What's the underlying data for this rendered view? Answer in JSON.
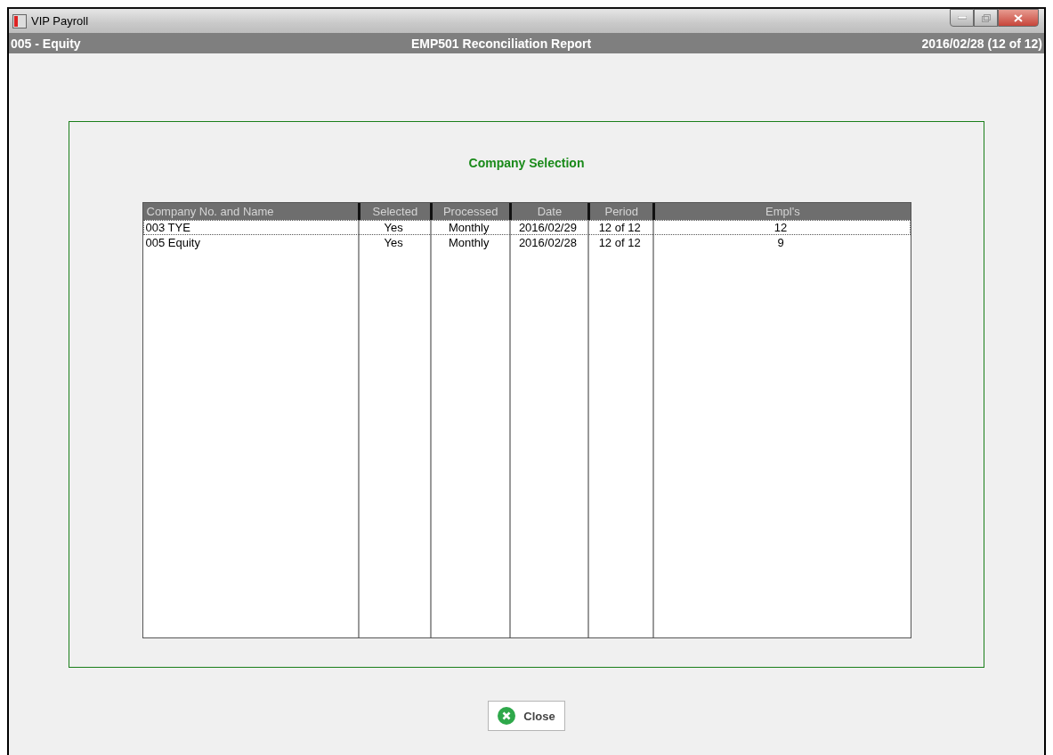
{
  "window": {
    "title": "VIP Payroll"
  },
  "header": {
    "company": "005 - Equity",
    "report": "EMP501 Reconciliation Report",
    "period": "2016/02/28 (12 of 12)"
  },
  "panel": {
    "title": "Company Selection"
  },
  "table": {
    "columns": [
      "Company No. and Name",
      "Selected",
      "Processed",
      "Date",
      "Period",
      "Empl's"
    ],
    "rows": [
      {
        "cells": [
          "003 TYE",
          "Yes",
          "Monthly",
          "2016/02/29",
          "12 of 12",
          "12"
        ],
        "selected": true
      },
      {
        "cells": [
          "005 Equity",
          "Yes",
          "Monthly",
          "2016/02/28",
          "12 of 12",
          "9"
        ],
        "selected": false
      }
    ]
  },
  "buttons": [
    {
      "label": "Close"
    }
  ]
}
